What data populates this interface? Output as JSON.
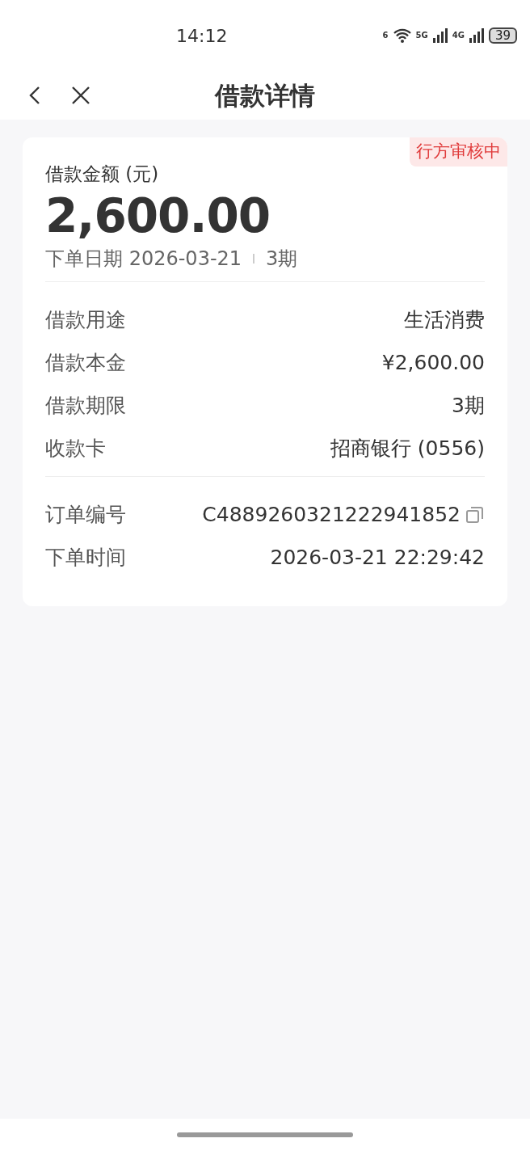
{
  "status_bar": {
    "time": "14:12",
    "wifi_label": "6",
    "networks": [
      "5G",
      "4G"
    ],
    "battery": "39"
  },
  "nav": {
    "title": "借款详情"
  },
  "summary": {
    "status": "行方审核中",
    "amount_label": "借款金额 (元)",
    "amount": "2,600.00",
    "date_text": "下单日期 2026-03-21",
    "term": "3期"
  },
  "groups": [
    {
      "rows": [
        {
          "label": "借款用途",
          "value": "生活消费",
          "copyable": false
        },
        {
          "label": "借款本金",
          "value": "¥2,600.00",
          "copyable": false
        },
        {
          "label": "借款期限",
          "value": "3期",
          "copyable": false
        },
        {
          "label": "收款卡",
          "value": "招商银行 (0556)",
          "copyable": false
        }
      ]
    },
    {
      "rows": [
        {
          "label": "订单编号",
          "value": "C4889260321222941852",
          "copyable": true
        },
        {
          "label": "下单时间",
          "value": "2026-03-21 22:29:42",
          "copyable": false
        }
      ]
    }
  ]
}
